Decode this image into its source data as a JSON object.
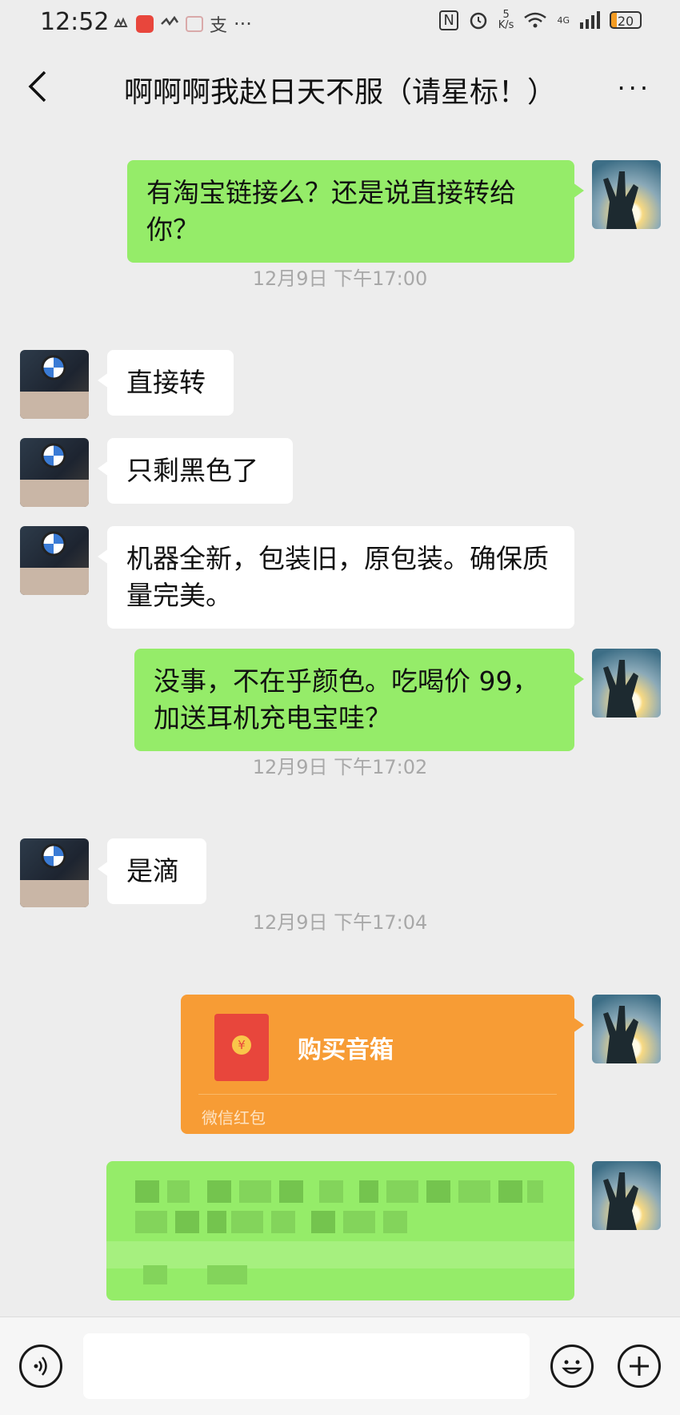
{
  "status_bar": {
    "time": "12:52",
    "left_icons": [
      "notification-icon",
      "app-icon",
      "app-icon",
      "app-icon",
      "alipay-icon"
    ],
    "more": "···",
    "nfc": "N",
    "speed_value": "5",
    "speed_unit": "K/s",
    "network": "4G",
    "battery": "20"
  },
  "nav": {
    "title": "啊啊啊我赵日天不服（请星标！）",
    "more": "···"
  },
  "messages": [
    {
      "from": "me",
      "text": "有淘宝链接么？还是说直接转给你？"
    },
    {
      "type": "time",
      "text": "12月9日 下午17:00"
    },
    {
      "from": "them",
      "text": "直接转"
    },
    {
      "from": "them",
      "text": "只剩黑色了"
    },
    {
      "from": "them",
      "text": "机器全新，包装旧，原包装。确保质量完美。"
    },
    {
      "from": "me",
      "text": "没事，不在乎颜色。吃喝价 99，加送耳机充电宝哇？"
    },
    {
      "type": "time",
      "text": "12月9日 下午17:02"
    },
    {
      "from": "them",
      "text": "是滴"
    },
    {
      "type": "time",
      "text": "12月9日 下午17:04"
    }
  ],
  "red_packet": {
    "title": "购买音箱",
    "footer": "微信红包",
    "coin": "¥"
  },
  "colors": {
    "background": "#ededed",
    "my_bubble": "#95ec69",
    "their_bubble": "#ffffff",
    "red_packet": "#f79c35",
    "timestamp": "#a8a8a8"
  }
}
